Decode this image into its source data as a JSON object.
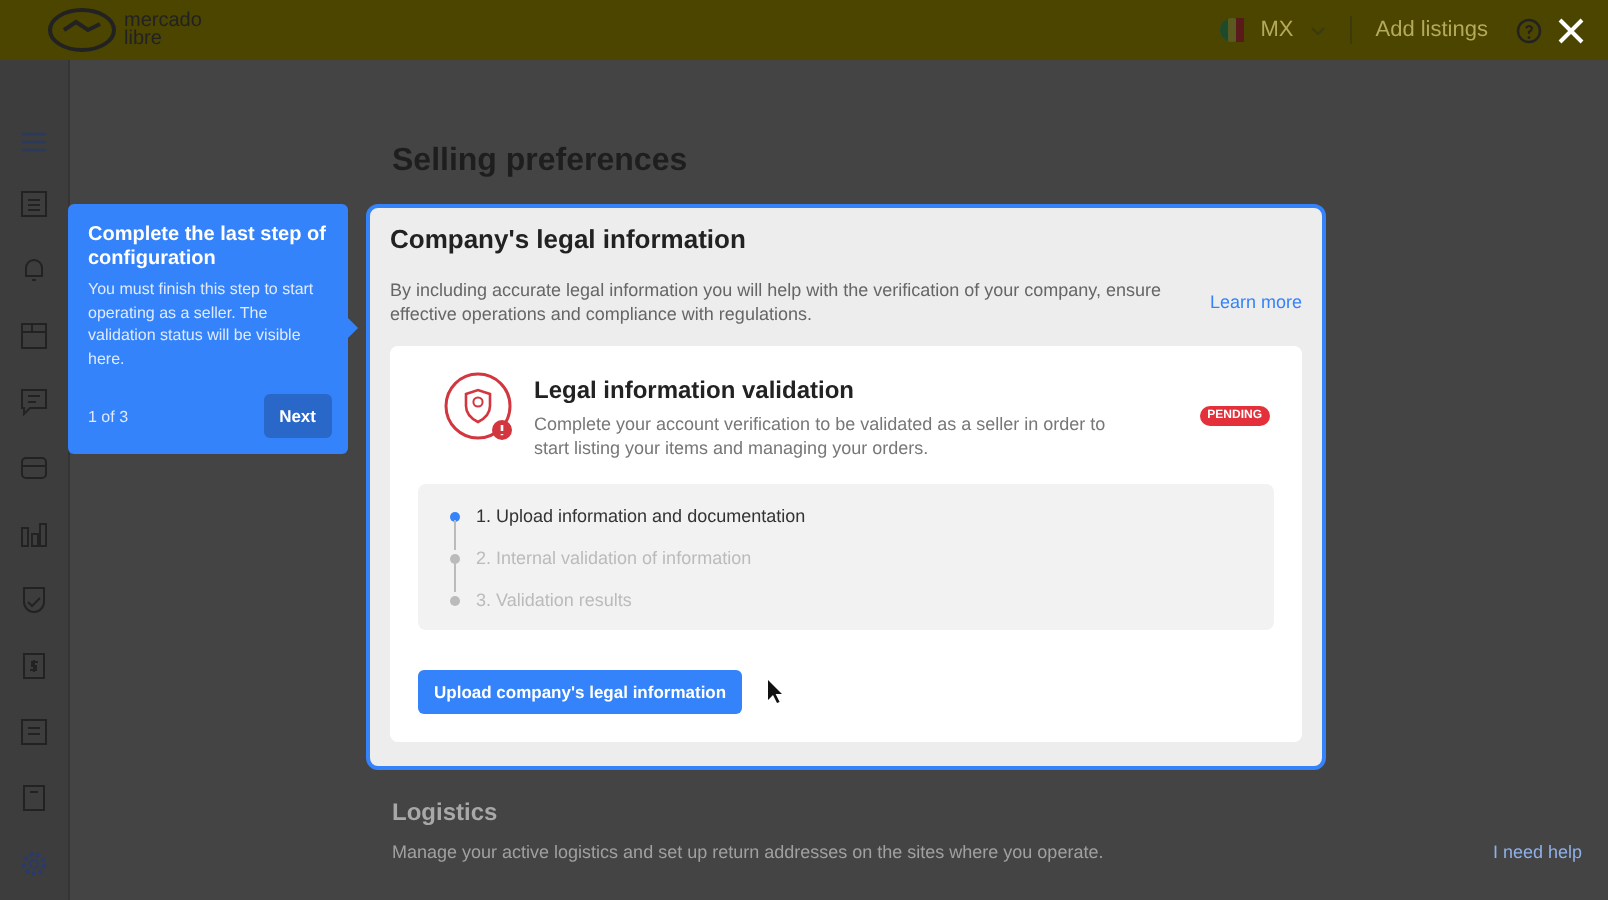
{
  "header": {
    "logo_text": [
      "mercado",
      "libre"
    ],
    "country": "MX",
    "add_listings": "Add listings"
  },
  "page": {
    "title": "Selling preferences"
  },
  "legal_card": {
    "title": "Company's legal information",
    "description": "By including accurate legal information you will help with the verification of your company, ensure effective operations and compliance with regulations.",
    "link": "Learn more",
    "validation": {
      "title": "Legal information validation",
      "description": "Complete your account verification to be validated as a seller in order to start listing your items and managing your orders.",
      "badge": "PENDING",
      "steps": [
        {
          "label": "1. Upload information and documentation",
          "active": true
        },
        {
          "label": "2. Internal validation of information",
          "active": false
        },
        {
          "label": "3. Validation results",
          "active": false
        }
      ],
      "button": "Upload company's legal information"
    }
  },
  "logistics": {
    "title": "Logistics",
    "description": "Manage your active logistics and set up return addresses on the sites where you operate.",
    "link": "I need help"
  },
  "tooltip": {
    "title": "Complete the last step of configuration",
    "body": "You must finish this step to start operating as a seller. The validation status will be visible here.",
    "counter": "1 of 3",
    "button": "Next"
  }
}
